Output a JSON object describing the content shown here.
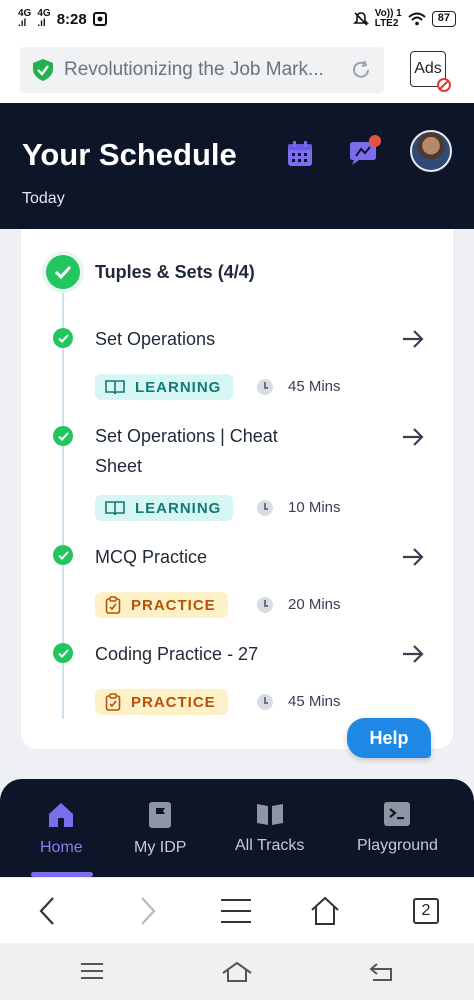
{
  "status_bar": {
    "network_1": "4G",
    "network_2": "4G",
    "time": "8:28",
    "volte": "Vo)) 1",
    "lte": "LTE2",
    "battery": "87"
  },
  "browser": {
    "address": "Revolutionizing the Job Mark...",
    "ads_label": "Ads",
    "tab_count": "2"
  },
  "header": {
    "title": "Your Schedule",
    "subtitle": "Today"
  },
  "schedule": {
    "section_title": "Tuples & Sets (4/4)",
    "items": [
      {
        "title": "Set Operations",
        "badge": "LEARNING",
        "duration": "45 Mins"
      },
      {
        "title": "Set Operations | Cheat Sheet",
        "badge": "LEARNING",
        "duration": "10 Mins"
      },
      {
        "title": "MCQ Practice",
        "badge": "PRACTICE",
        "duration": "20 Mins"
      },
      {
        "title": "Coding Practice - 27",
        "badge": "PRACTICE",
        "duration": "45 Mins"
      }
    ]
  },
  "help_label": "Help",
  "bottom_nav": {
    "items": [
      {
        "label": "Home",
        "icon": "home-icon",
        "active": true
      },
      {
        "label": "My IDP",
        "icon": "flag-icon",
        "active": false
      },
      {
        "label": "All Tracks",
        "icon": "book-icon",
        "active": false
      },
      {
        "label": "Playground",
        "icon": "terminal-icon",
        "active": false
      }
    ]
  },
  "colors": {
    "header_bg": "#0d1628",
    "accent": "#7c6cf0",
    "success": "#22c55e",
    "learning": "#0f7c78",
    "practice": "#b45309",
    "help": "#1e88e5"
  }
}
